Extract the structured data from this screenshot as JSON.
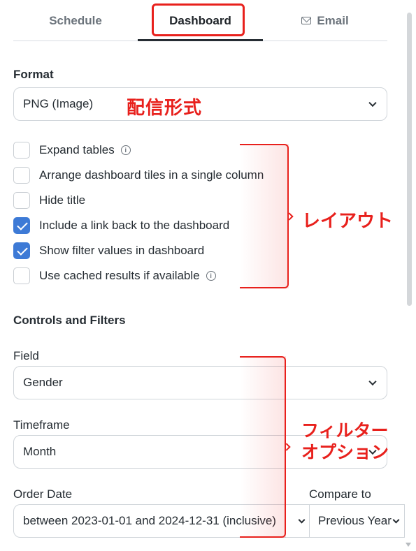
{
  "tabs": [
    {
      "label": "Schedule",
      "active": false
    },
    {
      "label": "Dashboard",
      "active": true
    },
    {
      "label": "Email",
      "active": false,
      "icon": "mail-icon"
    }
  ],
  "format": {
    "label": "Format",
    "value": "PNG (Image)",
    "annotation": "配信形式"
  },
  "options": [
    {
      "label": "Expand tables",
      "checked": false,
      "info": true
    },
    {
      "label": "Arrange dashboard tiles in a single column",
      "checked": false,
      "info": false
    },
    {
      "label": "Hide title",
      "checked": false,
      "info": false
    },
    {
      "label": "Include a link back to the dashboard",
      "checked": true,
      "info": false
    },
    {
      "label": "Show filter values in dashboard",
      "checked": true,
      "info": false
    },
    {
      "label": "Use cached results if available",
      "checked": false,
      "info": true
    }
  ],
  "layout_annotation": "レイアウト",
  "controls": {
    "heading": "Controls and Filters",
    "field_label": "Field",
    "field_value": "Gender",
    "timeframe_label": "Timeframe",
    "timeframe_value": "Month",
    "order_date_label": "Order Date",
    "order_date_value": "between 2023-01-01 and 2024-12-31 (inclusive)",
    "compare_label": "Compare to",
    "compare_value": "Previous Year",
    "annotation_line1": "フィルター",
    "annotation_line2": "オプション"
  },
  "colors": {
    "accent": "#3d7ad6",
    "annotation": "#e8201c"
  }
}
